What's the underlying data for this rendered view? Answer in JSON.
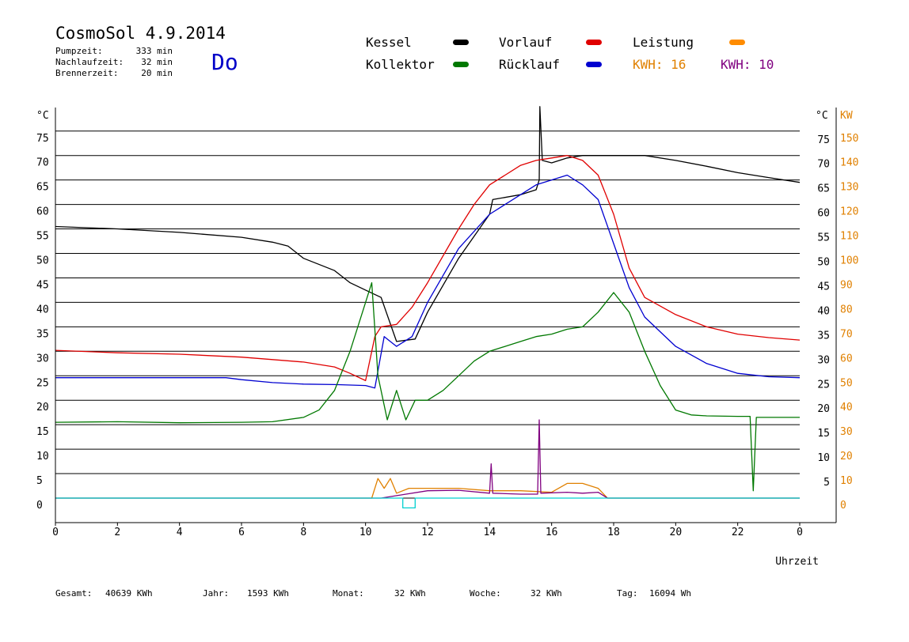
{
  "header": {
    "title": "CosmoSol 4.9.2014",
    "day": "Do",
    "stats": [
      {
        "label": "Pumpzeit:",
        "value": "333 min"
      },
      {
        "label": "Nachlaufzeit:",
        "value": "32 min"
      },
      {
        "label": "Brennerzeit:",
        "value": "20 min"
      }
    ]
  },
  "legend": {
    "items": [
      {
        "label": "Kessel",
        "color": "#000000"
      },
      {
        "label": "Kollektor",
        "color": "#007800"
      },
      {
        "label": "Vorlauf",
        "color": "#e00000"
      },
      {
        "label": "Rücklauf",
        "color": "#0000d0"
      },
      {
        "label": "Leistung",
        "color": "#ff8c00"
      }
    ],
    "kwh_orange": "KWH: 16",
    "kwh_purple": "KWH: 10",
    "orange": "#e08000",
    "purple": "#800080"
  },
  "footer": {
    "gesamt_label": "Gesamt:",
    "gesamt_value": "40639 KWh",
    "jahr_label": "Jahr:",
    "jahr_value": "1593 KWh",
    "monat_label": "Monat:",
    "monat_value": "32 KWh",
    "woche_label": "Woche:",
    "woche_value": "32 KWh",
    "tag_label": "Tag:",
    "tag_value": "16094 Wh"
  },
  "chart_data": {
    "type": "line",
    "xlabel": "Uhrzeit",
    "ylabel_left": "°C",
    "ylabel_right": "KW",
    "xlim": [
      0,
      24
    ],
    "ylim_left": [
      0,
      80
    ],
    "ylim_right": [
      0,
      160
    ],
    "x_ticks": [
      "0",
      "2",
      "4",
      "6",
      "8",
      "10",
      "12",
      "14",
      "16",
      "18",
      "20",
      "22",
      "0"
    ],
    "y_ticks_left": [
      "0",
      "5",
      "10",
      "15",
      "20",
      "25",
      "30",
      "35",
      "40",
      "45",
      "50",
      "55",
      "60",
      "65",
      "70",
      "75"
    ],
    "y_ticks_right_degC": [
      "5",
      "10",
      "15",
      "20",
      "25",
      "30",
      "35",
      "40",
      "45",
      "50",
      "55",
      "60",
      "65",
      "70",
      "75"
    ],
    "y_ticks_right_kw": [
      "0",
      "10",
      "20",
      "30",
      "40",
      "50",
      "60",
      "70",
      "80",
      "90",
      "100",
      "110",
      "120",
      "130",
      "140",
      "150"
    ],
    "grid": true,
    "series": [
      {
        "name": "Kessel",
        "color": "#000000",
        "points": [
          [
            0,
            55.5
          ],
          [
            2,
            55
          ],
          [
            4,
            54.3
          ],
          [
            6,
            53.3
          ],
          [
            7,
            52.3
          ],
          [
            7.5,
            51.5
          ],
          [
            8,
            49
          ],
          [
            9,
            46.5
          ],
          [
            9.5,
            44
          ],
          [
            10,
            42.5
          ],
          [
            10.5,
            41
          ],
          [
            11,
            32
          ],
          [
            11.6,
            32.5
          ],
          [
            12,
            38
          ],
          [
            13,
            49
          ],
          [
            14,
            58
          ],
          [
            14.1,
            61
          ],
          [
            15,
            62
          ],
          [
            15.5,
            63
          ],
          [
            15.6,
            65
          ],
          [
            15.62,
            80
          ],
          [
            15.7,
            69
          ],
          [
            16,
            68.5
          ],
          [
            16.5,
            69.5
          ],
          [
            17,
            70
          ],
          [
            18,
            70
          ],
          [
            19,
            70
          ],
          [
            20,
            69
          ],
          [
            21,
            67.8
          ],
          [
            22,
            66.5
          ],
          [
            23,
            65.5
          ],
          [
            24,
            64.5
          ]
        ]
      },
      {
        "name": "Vorlauf",
        "color": "#e00000",
        "points": [
          [
            0,
            30.2
          ],
          [
            2,
            29.7
          ],
          [
            4,
            29.4
          ],
          [
            6,
            28.8
          ],
          [
            8,
            27.8
          ],
          [
            9,
            26.8
          ],
          [
            9.5,
            25.5
          ],
          [
            10,
            24
          ],
          [
            10.3,
            33
          ],
          [
            10.5,
            35
          ],
          [
            11,
            35.5
          ],
          [
            11.5,
            39
          ],
          [
            12,
            44
          ],
          [
            13,
            55
          ],
          [
            13.5,
            60
          ],
          [
            14,
            64
          ],
          [
            14.5,
            66
          ],
          [
            15,
            68
          ],
          [
            15.5,
            69
          ],
          [
            16,
            69.5
          ],
          [
            16.5,
            70
          ],
          [
            17,
            69
          ],
          [
            17.5,
            66
          ],
          [
            18,
            58
          ],
          [
            18.5,
            47
          ],
          [
            19,
            41
          ],
          [
            20,
            37.5
          ],
          [
            21,
            35
          ],
          [
            22,
            33.5
          ],
          [
            23,
            32.8
          ],
          [
            24,
            32.3
          ]
        ]
      },
      {
        "name": "Rücklauf",
        "color": "#0000d0",
        "points": [
          [
            0,
            24.6
          ],
          [
            2,
            24.6
          ],
          [
            4,
            24.6
          ],
          [
            5.5,
            24.6
          ],
          [
            6,
            24.2
          ],
          [
            7,
            23.6
          ],
          [
            8,
            23.3
          ],
          [
            9,
            23.2
          ],
          [
            10,
            23
          ],
          [
            10.3,
            22.5
          ],
          [
            10.6,
            33
          ],
          [
            11,
            31
          ],
          [
            11.5,
            33
          ],
          [
            12,
            40
          ],
          [
            13,
            51
          ],
          [
            14,
            58
          ],
          [
            14.5,
            60
          ],
          [
            15,
            62
          ],
          [
            15.5,
            64
          ],
          [
            16,
            65
          ],
          [
            16.5,
            66
          ],
          [
            17,
            64
          ],
          [
            17.5,
            61
          ],
          [
            18,
            52
          ],
          [
            18.5,
            43
          ],
          [
            19,
            37
          ],
          [
            20,
            31
          ],
          [
            21,
            27.5
          ],
          [
            22,
            25.5
          ],
          [
            23,
            24.8
          ],
          [
            24,
            24.6
          ]
        ]
      },
      {
        "name": "Kollektor",
        "color": "#007800",
        "points": [
          [
            0,
            15.5
          ],
          [
            2,
            15.6
          ],
          [
            4,
            15.4
          ],
          [
            6,
            15.5
          ],
          [
            7,
            15.6
          ],
          [
            8,
            16.5
          ],
          [
            8.5,
            18
          ],
          [
            9,
            22
          ],
          [
            9.5,
            30
          ],
          [
            10,
            40
          ],
          [
            10.2,
            44
          ],
          [
            10.4,
            25
          ],
          [
            10.7,
            16
          ],
          [
            11,
            22
          ],
          [
            11.3,
            16
          ],
          [
            11.6,
            20
          ],
          [
            12,
            20
          ],
          [
            12.5,
            22
          ],
          [
            13,
            25
          ],
          [
            13.5,
            28
          ],
          [
            14,
            30
          ],
          [
            14.5,
            31
          ],
          [
            15,
            32
          ],
          [
            15.5,
            33
          ],
          [
            16,
            33.5
          ],
          [
            16.5,
            34.5
          ],
          [
            17,
            35
          ],
          [
            17.5,
            38
          ],
          [
            18,
            42
          ],
          [
            18.5,
            38
          ],
          [
            19,
            30
          ],
          [
            19.5,
            23
          ],
          [
            20,
            18
          ],
          [
            20.5,
            17
          ],
          [
            21,
            16.8
          ],
          [
            22,
            16.7
          ],
          [
            22.4,
            16.7
          ],
          [
            22.5,
            1.5
          ],
          [
            22.6,
            16.5
          ],
          [
            23,
            16.5
          ],
          [
            24,
            16.5
          ]
        ]
      },
      {
        "name": "Leistung",
        "color": "#e08000",
        "points": [
          [
            0,
            0
          ],
          [
            10.2,
            0
          ],
          [
            10.4,
            4
          ],
          [
            10.6,
            2
          ],
          [
            10.8,
            4
          ],
          [
            11,
            1
          ],
          [
            11.4,
            2
          ],
          [
            11.8,
            2
          ],
          [
            12.5,
            2
          ],
          [
            13,
            2
          ],
          [
            14,
            1.5
          ],
          [
            15,
            1.5
          ],
          [
            16,
            1.2
          ],
          [
            16.5,
            3
          ],
          [
            17,
            3
          ],
          [
            17.5,
            2
          ],
          [
            17.8,
            0
          ],
          [
            24,
            0
          ]
        ]
      },
      {
        "name": "",
        "color": "#800080",
        "points": [
          [
            0,
            0
          ],
          [
            10.5,
            0
          ],
          [
            11,
            0.5
          ],
          [
            12,
            1.5
          ],
          [
            13,
            1.6
          ],
          [
            14,
            1
          ],
          [
            14.05,
            7
          ],
          [
            14.1,
            1
          ],
          [
            15,
            0.8
          ],
          [
            15.55,
            0.8
          ],
          [
            15.6,
            16
          ],
          [
            15.65,
            1
          ],
          [
            16.5,
            1.2
          ],
          [
            17,
            1
          ],
          [
            17.5,
            1.2
          ],
          [
            17.8,
            0
          ],
          [
            24,
            0
          ]
        ]
      },
      {
        "name": "",
        "color": "#00d0d0",
        "points": [
          [
            0,
            0
          ],
          [
            11.2,
            0
          ],
          [
            11.2,
            -2
          ],
          [
            11.6,
            -2
          ],
          [
            11.6,
            0
          ],
          [
            24,
            0
          ]
        ]
      }
    ]
  }
}
